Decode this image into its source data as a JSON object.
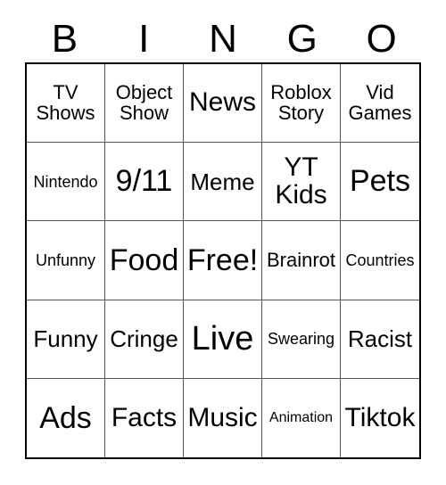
{
  "card": {
    "header_letters": [
      "B",
      "I",
      "N",
      "G",
      "O"
    ],
    "columns": 5,
    "rows": 5,
    "cells": [
      {
        "text": "TV\nShows",
        "size": "md"
      },
      {
        "text": "Object\nShow",
        "size": "md"
      },
      {
        "text": "News",
        "size": "xl"
      },
      {
        "text": "Roblox\nStory",
        "size": "md"
      },
      {
        "text": "Vid\nGames",
        "size": "md"
      },
      {
        "text": "Nintendo",
        "size": "sm"
      },
      {
        "text": "9/11",
        "size": "xxl"
      },
      {
        "text": "Meme",
        "size": "lg"
      },
      {
        "text": "YT\nKids",
        "size": "xl"
      },
      {
        "text": "Pets",
        "size": "xxl"
      },
      {
        "text": "Unfunny",
        "size": "sm"
      },
      {
        "text": "Food",
        "size": "xxl"
      },
      {
        "text": "Free!",
        "size": "xxl"
      },
      {
        "text": "Brainrot",
        "size": "md"
      },
      {
        "text": "Countries",
        "size": "sm"
      },
      {
        "text": "Funny",
        "size": "lg"
      },
      {
        "text": "Cringe",
        "size": "lg"
      },
      {
        "text": "Live",
        "size": "huge"
      },
      {
        "text": "Swearing",
        "size": "sm"
      },
      {
        "text": "Racist",
        "size": "lg"
      },
      {
        "text": "Ads",
        "size": "xxl"
      },
      {
        "text": "Facts",
        "size": "xl"
      },
      {
        "text": "Music",
        "size": "xl"
      },
      {
        "text": "Animation",
        "size": "xs"
      },
      {
        "text": "Tiktok",
        "size": "xl"
      }
    ],
    "colors": {
      "background": "#ffffff",
      "text": "#000000",
      "grid_outer_border": "#000000",
      "grid_inner_border": "#555555"
    }
  }
}
